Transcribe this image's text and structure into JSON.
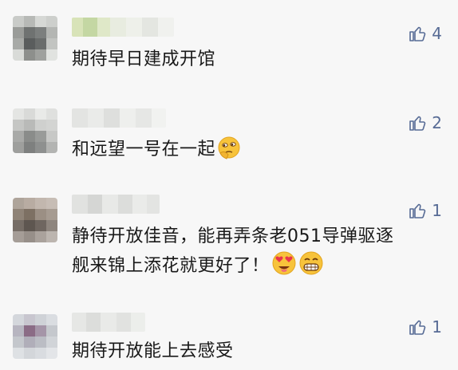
{
  "colors": {
    "background": "#f7f7f7",
    "text": "#191919",
    "like": "#576b95"
  },
  "comments": [
    {
      "text": "期待早日建成开馆",
      "likes": "4",
      "emojis": []
    },
    {
      "text": "和远望一号在一起",
      "likes": "2",
      "emojis": [
        "thinking-smug-emoji"
      ]
    },
    {
      "text": "静待开放佳音，能再弄条老051导弹驱逐\n舰来锦上添花就更好了！",
      "likes": "1",
      "emojis": [
        "heart-eyes-emoji",
        "grin-emoji"
      ]
    },
    {
      "text": "期待开放能上去感受",
      "likes": "1",
      "emojis": []
    }
  ],
  "icons": {
    "like": "thumbs-up-icon"
  }
}
